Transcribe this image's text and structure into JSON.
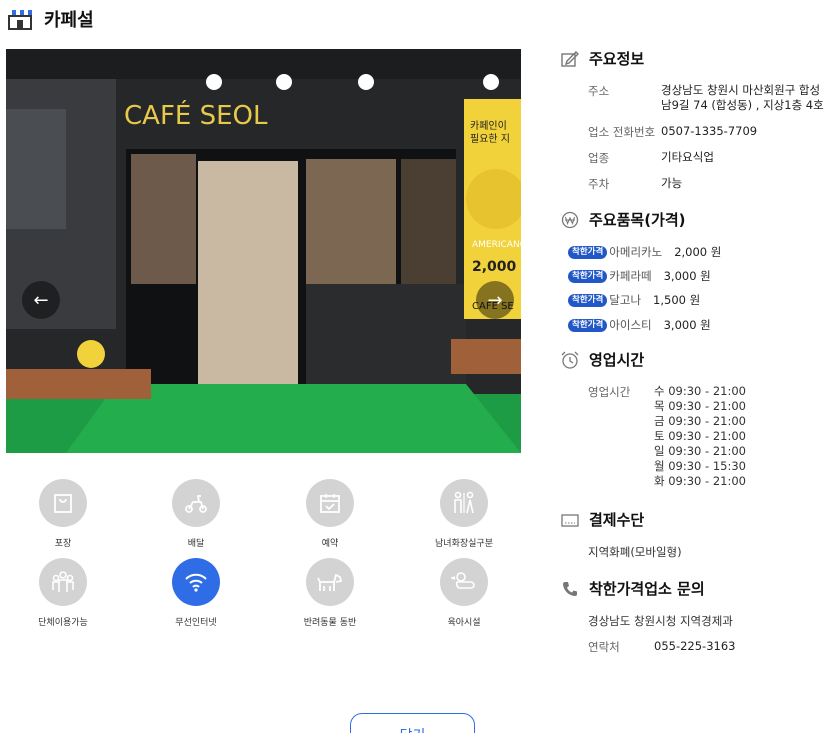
{
  "header": {
    "title": "카페설"
  },
  "photo": {
    "sign_text": "CAFÉ SEOL",
    "banner_text_1": "카페인이",
    "banner_text_2": "필요한 지",
    "banner_text_3": "AMERICANO",
    "banner_text_4": "2,000",
    "banner_text_5": "CAFE SE"
  },
  "amenities": [
    {
      "label": "포장",
      "active": false
    },
    {
      "label": "배달",
      "active": false
    },
    {
      "label": "예약",
      "active": false
    },
    {
      "label": "남녀화장실구분",
      "active": false
    },
    {
      "label": "단체이용가능",
      "active": false
    },
    {
      "label": "무선인터넷",
      "active": true
    },
    {
      "label": "반려동물 동반",
      "active": false
    },
    {
      "label": "육아시설",
      "active": false
    }
  ],
  "info": {
    "title": "주요정보",
    "address_label": "주소",
    "address_line1": "경상남도 창원시 마산회원구 합성",
    "address_line2": "남9길 74 (합성동) , 지상1층 4호",
    "phone_label": "업소 전화번호",
    "phone": "0507-1335-7709",
    "type_label": "업종",
    "type": "기타요식업",
    "parking_label": "주차",
    "parking": "가능"
  },
  "menu": {
    "title": "주요품목(가격)",
    "badge": "착한가격",
    "items": [
      {
        "name": "아메리카노",
        "price": "2,000 원"
      },
      {
        "name": "카페라떼",
        "price": "3,000 원"
      },
      {
        "name": "달고나",
        "price": "1,500 원"
      },
      {
        "name": "아이스티",
        "price": "3,000 원"
      }
    ]
  },
  "hours": {
    "title": "영업시간",
    "label": "영업시간",
    "days": [
      "수 09:30 - 21:00",
      "목 09:30 - 21:00",
      "금 09:30 - 21:00",
      "토 09:30 - 21:00",
      "일 09:30 - 21:00",
      "월 09:30 - 15:30",
      "화 09:30 - 21:00"
    ]
  },
  "payment": {
    "title": "결제수단",
    "value": "지역화폐(모바일형)"
  },
  "contact": {
    "title": "착한가격업소 문의",
    "org": "경상남도 창원시청 지역경제과",
    "phone_label": "연락처",
    "phone": "055-225-3163"
  },
  "close_label": "닫기",
  "colors": {
    "accent": "#2f6de6",
    "badge": "#2157c6",
    "amenity_off": "#d3d3d3"
  }
}
